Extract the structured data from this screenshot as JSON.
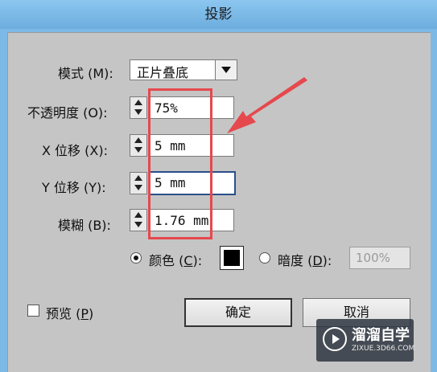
{
  "window": {
    "title": "投影"
  },
  "mode": {
    "label": "模式 (M):",
    "value": "正片叠底"
  },
  "opacity": {
    "label": "不透明度 (O):",
    "value": "75%"
  },
  "x_offset": {
    "label": "X 位移 (X):",
    "value": "5 mm"
  },
  "y_offset": {
    "label": "Y 位移 (Y):",
    "value": "5 mm"
  },
  "blur": {
    "label": "模糊 (B):",
    "value": "1.76 mm"
  },
  "color_option": {
    "label_pre": "颜色 (",
    "mnemonic": "C",
    "label_post": "):",
    "selected": true,
    "swatch": "#000000"
  },
  "darkness_option": {
    "label_pre": "暗度 (",
    "mnemonic": "D",
    "label_post": "):",
    "selected": false,
    "value": "100%"
  },
  "preview": {
    "label_pre": "预览 (",
    "mnemonic": "P",
    "label_post": ")",
    "checked": false
  },
  "buttons": {
    "ok": "确定",
    "cancel": "取消"
  },
  "annotation": {
    "color": "#e5484d"
  },
  "watermark": {
    "name": "溜溜自学",
    "site": "ZIXUE.3D66.COM"
  }
}
